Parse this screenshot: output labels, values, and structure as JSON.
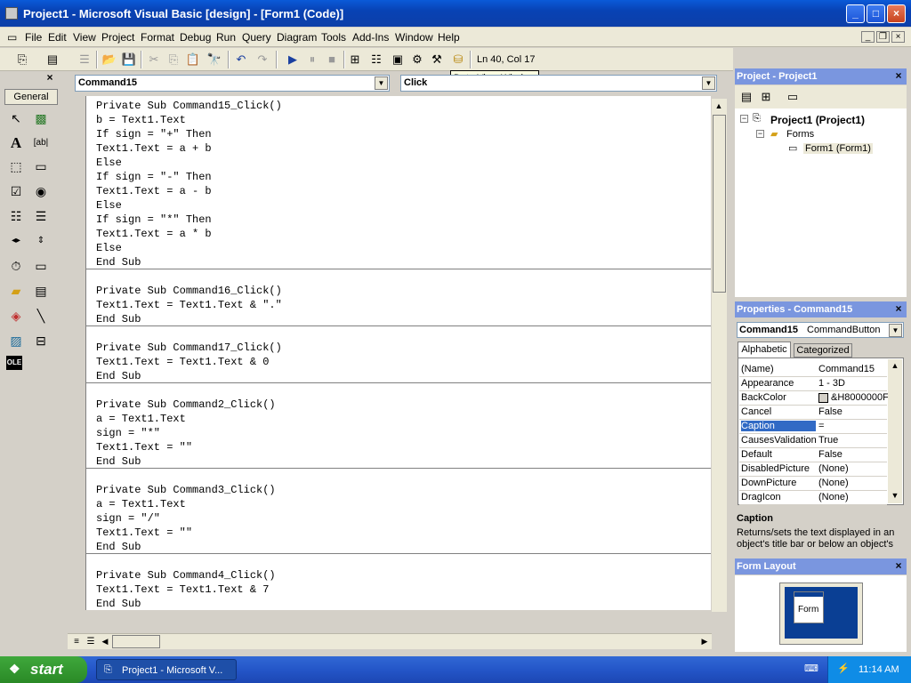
{
  "window": {
    "title": "Project1 - Microsoft Visual Basic [design] - [Form1 (Code)]",
    "min": "_",
    "max": "□",
    "close": "×"
  },
  "menu": [
    "File",
    "Edit",
    "View",
    "Project",
    "Format",
    "Debug",
    "Run",
    "Query",
    "Diagram",
    "Tools",
    "Add-Ins",
    "Window",
    "Help"
  ],
  "toolbar": {
    "position": "Ln 40, Col 17",
    "tooltip": "Data View Window"
  },
  "toolbox": {
    "tab": "General"
  },
  "code": {
    "object": "Command15",
    "procedure": "Click",
    "lines": [
      "Private Sub Command15_Click()",
      "b = Text1.Text",
      "If sign = \"+\" Then",
      "Text1.Text = a + b",
      "Else",
      "If sign = \"-\" Then",
      "Text1.Text = a - b",
      "Else",
      "If sign = \"*\" Then",
      "Text1.Text = a * b",
      "Else",
      "End Sub",
      "",
      "Private Sub Command16_Click()",
      "Text1.Text = Text1.Text & \".\"",
      "End Sub",
      "",
      "Private Sub Command17_Click()",
      "Text1.Text = Text1.Text & 0",
      "End Sub",
      "",
      "Private Sub Command2_Click()",
      "a = Text1.Text",
      "sign = \"*\"",
      "Text1.Text = \"\"",
      "End Sub",
      "",
      "Private Sub Command3_Click()",
      "a = Text1.Text",
      "sign = \"/\"",
      "Text1.Text = \"\"",
      "End Sub",
      "",
      "Private Sub Command4_Click()",
      "Text1.Text = Text1.Text & 7",
      "End Sub"
    ]
  },
  "project": {
    "title": "Project - Project1",
    "root": "Project1 (Project1)",
    "folder": "Forms",
    "form": "Form1 (Form1)"
  },
  "properties": {
    "title": "Properties - Command15",
    "object": "Command15",
    "type": "CommandButton",
    "tabs": [
      "Alphabetic",
      "Categorized"
    ],
    "rows": [
      {
        "name": "(Name)",
        "value": "Command15"
      },
      {
        "name": "Appearance",
        "value": "1 - 3D"
      },
      {
        "name": "BackColor",
        "value": "&H8000000F"
      },
      {
        "name": "Cancel",
        "value": "False"
      },
      {
        "name": "Caption",
        "value": "="
      },
      {
        "name": "CausesValidation",
        "value": "True"
      },
      {
        "name": "Default",
        "value": "False"
      },
      {
        "name": "DisabledPicture",
        "value": "(None)"
      },
      {
        "name": "DownPicture",
        "value": "(None)"
      },
      {
        "name": "DragIcon",
        "value": "(None)"
      }
    ],
    "desc_title": "Caption",
    "desc_text": "Returns/sets the text displayed in an object's title bar or below an object's"
  },
  "formlayout": {
    "title": "Form Layout",
    "form_label": "Form"
  },
  "taskbar": {
    "start": "start",
    "item": "Project1 - Microsoft V...",
    "time": "11:14 AM"
  }
}
